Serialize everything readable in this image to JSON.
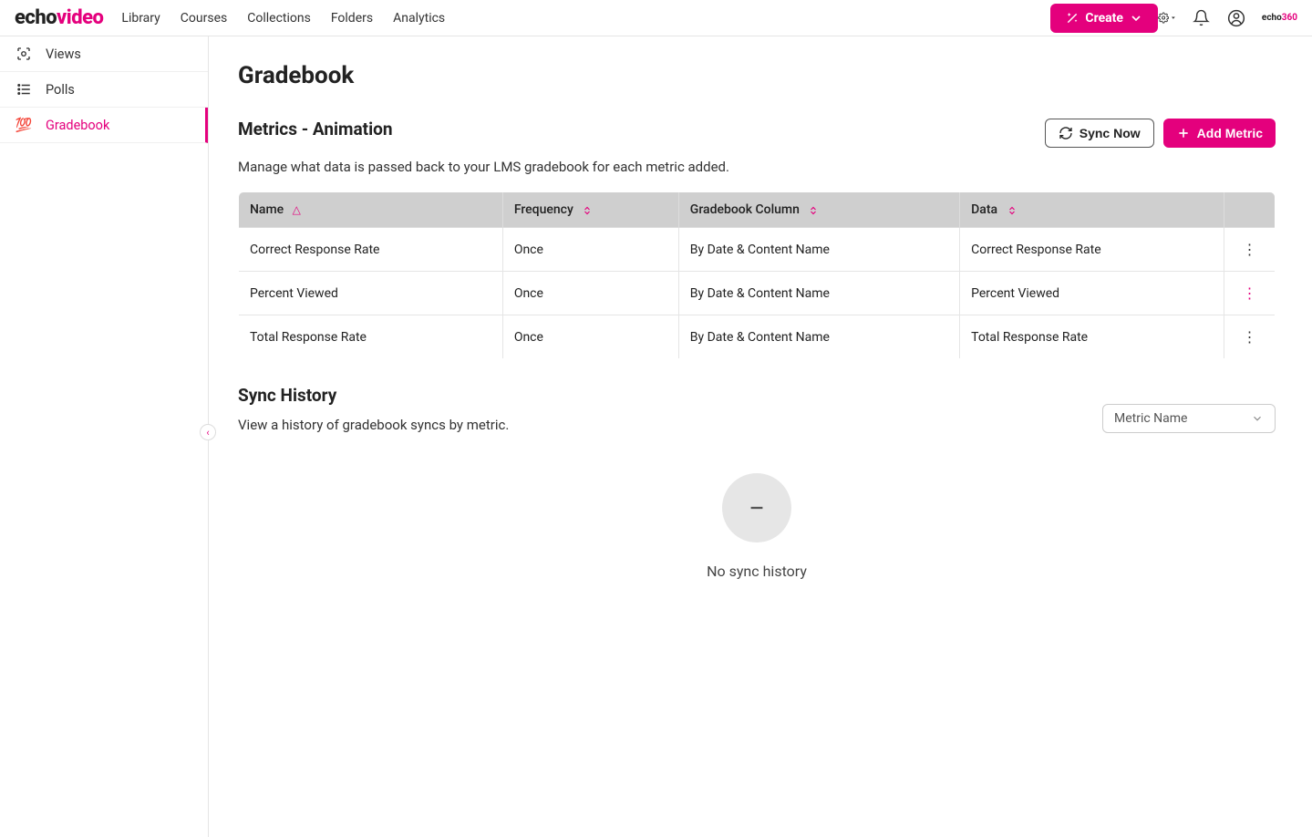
{
  "brand": {
    "part1": "echo",
    "part2": "video"
  },
  "nav": {
    "items": [
      "Library",
      "Courses",
      "Collections",
      "Folders",
      "Analytics"
    ],
    "create_label": "Create"
  },
  "top_right_brand": {
    "part1": "echo",
    "part2": "360"
  },
  "sidebar": {
    "items": [
      {
        "label": "Views",
        "icon": "views"
      },
      {
        "label": "Polls",
        "icon": "polls"
      },
      {
        "label": "Gradebook",
        "icon": "gradebook",
        "active": true
      }
    ]
  },
  "page": {
    "title": "Gradebook",
    "metrics_title": "Metrics - Animation",
    "metrics_sub": "Manage what data is passed back to your LMS gradebook for each metric added.",
    "sync_now_label": "Sync Now",
    "add_metric_label": "Add Metric",
    "table": {
      "headers": [
        "Name",
        "Frequency",
        "Gradebook Column",
        "Data"
      ],
      "rows": [
        {
          "name": "Correct Response Rate",
          "frequency": "Once",
          "column": "By Date & Content Name",
          "data": "Correct Response Rate",
          "highlight": false
        },
        {
          "name": "Percent Viewed",
          "frequency": "Once",
          "column": "By Date & Content Name",
          "data": "Percent Viewed",
          "highlight": true
        },
        {
          "name": "Total Response Rate",
          "frequency": "Once",
          "column": "By Date & Content Name",
          "data": "Total Response Rate",
          "highlight": false
        }
      ]
    },
    "sync_history_title": "Sync History",
    "sync_history_sub": "View a history of gradebook syncs by metric.",
    "metric_select_label": "Metric Name",
    "empty_state_text": "No sync history"
  }
}
